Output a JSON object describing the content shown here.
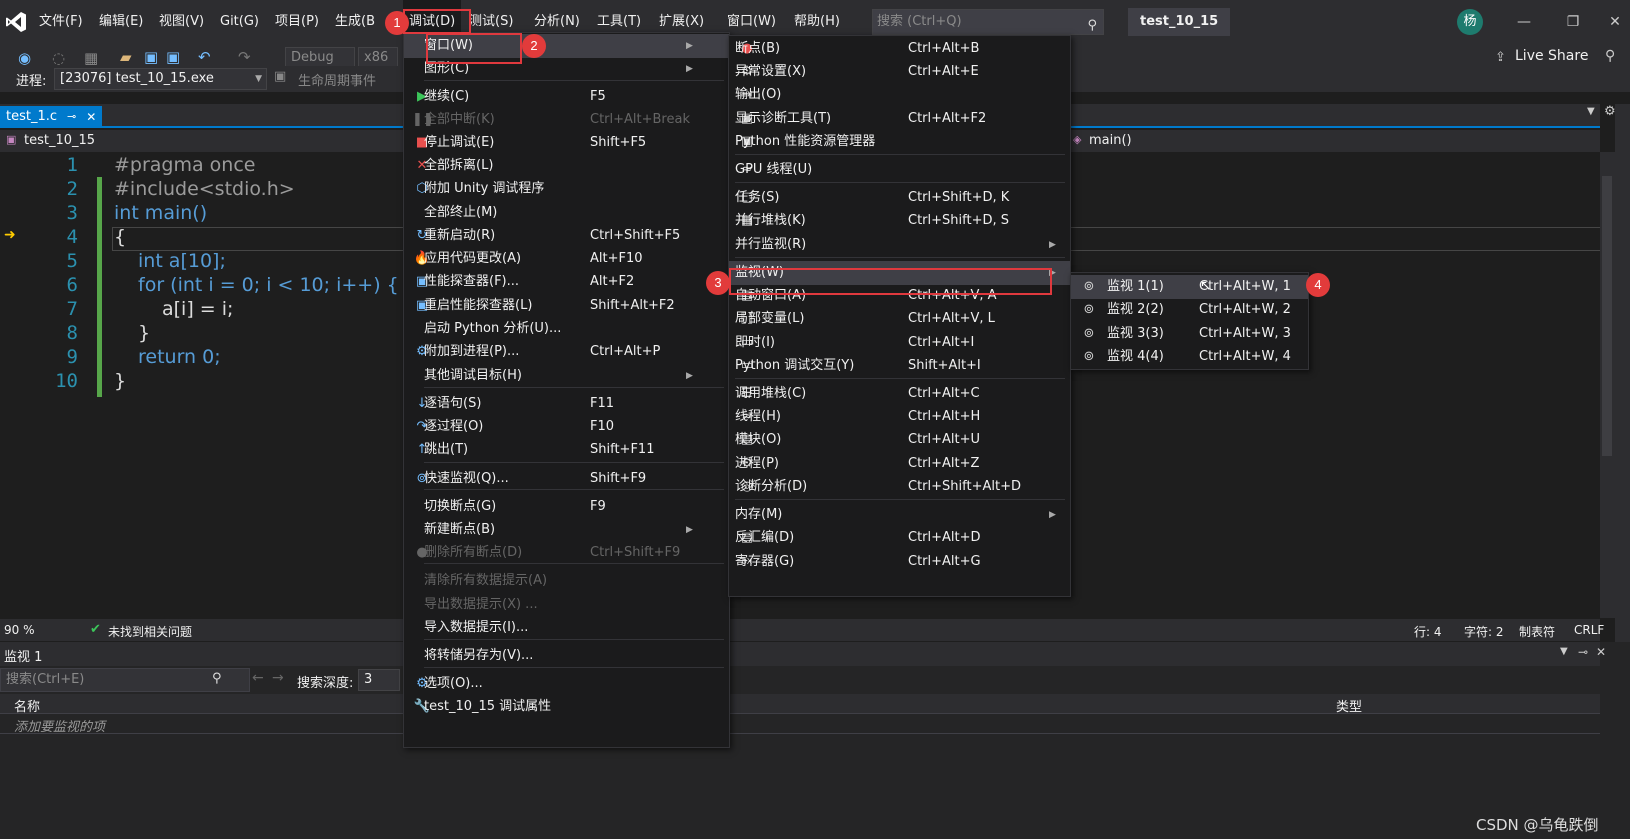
{
  "menubar": {
    "items": [
      "文件(F)",
      "编辑(E)",
      "视图(V)",
      "Git(G)",
      "项目(P)",
      "生成(B",
      "调试(D)",
      "测试(S)",
      "分析(N)",
      "工具(T)",
      "扩展(X)",
      "窗口(W)",
      "帮助(H)"
    ],
    "search_placeholder": "搜索 (Ctrl+Q)",
    "solution_name": "test_10_15",
    "avatar_initial": "杨",
    "live_share": "Live Share"
  },
  "toolbar": {
    "config": "Debug",
    "platform": "x86",
    "process_label": "进程:",
    "process_value": "[23076] test_10_15.exe",
    "lifecycle_label": "生命周期事件"
  },
  "tab": {
    "title": "test_1.c",
    "pin": "⊸",
    "close": "✕"
  },
  "navbar": {
    "project": "test_10_15",
    "member": "main()"
  },
  "editor": {
    "line_numbers": [
      "1",
      "2",
      "3",
      "4",
      "5",
      "6",
      "7",
      "8",
      "9",
      "10"
    ],
    "lines": [
      "#pragma once",
      "#include<stdio.h>",
      "int main()",
      "{",
      "    int a[10];",
      "    for (int i = 0; i < 10; i++) {",
      "        a[i] = i;",
      "    }",
      "    return 0;",
      "}"
    ]
  },
  "status": {
    "zoom": "90 %",
    "no_issues": "未找到相关问题",
    "line": "行: 4",
    "col": "字符: 2",
    "tab_mode": "制表符",
    "eol": "CRLF"
  },
  "watch": {
    "title": "监视 1",
    "search_placeholder": "搜索(Ctrl+E)",
    "depth_label": "搜索深度:",
    "depth_value": "3",
    "col_name": "名称",
    "col_type": "类型",
    "add_item": "添加要监视的项"
  },
  "debug_menu": {
    "items": [
      {
        "label": "窗口(W)",
        "shortcut": "",
        "icon": "",
        "submenu": true,
        "disabled": false,
        "highlighted": true
      },
      {
        "label": "图形(C)",
        "shortcut": "",
        "icon": "",
        "submenu": true,
        "disabled": false
      },
      {
        "label": "继续(C)",
        "shortcut": "F5",
        "icon": "▶",
        "disabled": false
      },
      {
        "label": "全部中断(K)",
        "shortcut": "Ctrl+Alt+Break",
        "icon": "❚❚",
        "disabled": true
      },
      {
        "label": "停止调试(E)",
        "shortcut": "Shift+F5",
        "icon": "■",
        "disabled": false
      },
      {
        "label": "全部拆离(L)",
        "shortcut": "",
        "icon": "✕",
        "disabled": false
      },
      {
        "label": "附加 Unity 调试程序",
        "shortcut": "",
        "icon": "⬡",
        "disabled": false
      },
      {
        "label": "全部终止(M)",
        "shortcut": "",
        "icon": "",
        "disabled": false
      },
      {
        "label": "重新启动(R)",
        "shortcut": "Ctrl+Shift+F5",
        "icon": "↻",
        "disabled": false
      },
      {
        "label": "应用代码更改(A)",
        "shortcut": "Alt+F10",
        "icon": "🔥",
        "disabled": false
      },
      {
        "label": "性能探查器(F)...",
        "shortcut": "Alt+F2",
        "icon": "▣",
        "disabled": false
      },
      {
        "label": "重启性能探查器(L)",
        "shortcut": "Shift+Alt+F2",
        "icon": "▣",
        "disabled": false
      },
      {
        "label": "启动 Python 分析(U)...",
        "shortcut": "",
        "icon": "",
        "disabled": false
      },
      {
        "label": "附加到进程(P)...",
        "shortcut": "Ctrl+Alt+P",
        "icon": "⚙",
        "disabled": false
      },
      {
        "label": "其他调试目标(H)",
        "shortcut": "",
        "icon": "",
        "submenu": true,
        "disabled": false
      },
      {
        "label": "逐语句(S)",
        "shortcut": "F11",
        "icon": "↓",
        "disabled": false
      },
      {
        "label": "逐过程(O)",
        "shortcut": "F10",
        "icon": "↷",
        "disabled": false
      },
      {
        "label": "跳出(T)",
        "shortcut": "Shift+F11",
        "icon": "↑",
        "disabled": false
      },
      {
        "label": "快速监视(Q)...",
        "shortcut": "Shift+F9",
        "icon": "⊚",
        "disabled": false
      },
      {
        "label": "切换断点(G)",
        "shortcut": "F9",
        "icon": "",
        "disabled": false
      },
      {
        "label": "新建断点(B)",
        "shortcut": "",
        "icon": "",
        "submenu": true,
        "disabled": false
      },
      {
        "label": "删除所有断点(D)",
        "shortcut": "Ctrl+Shift+F9",
        "icon": "●",
        "disabled": true
      },
      {
        "label": "清除所有数据提示(A)",
        "shortcut": "",
        "icon": "",
        "disabled": true
      },
      {
        "label": "导出数据提示(X) ...",
        "shortcut": "",
        "icon": "",
        "disabled": true
      },
      {
        "label": "导入数据提示(I)...",
        "shortcut": "",
        "icon": "",
        "disabled": false
      },
      {
        "label": "将转储另存为(V)...",
        "shortcut": "",
        "icon": "",
        "disabled": false
      },
      {
        "label": "选项(O)...",
        "shortcut": "",
        "icon": "⚙",
        "disabled": false
      },
      {
        "label": "test_10_15 调试属性",
        "shortcut": "",
        "icon": "🔧",
        "disabled": false
      }
    ]
  },
  "window_menu": {
    "items": [
      {
        "label": "断点(B)",
        "shortcut": "Ctrl+Alt+B",
        "icon": "●"
      },
      {
        "label": "异常设置(X)",
        "shortcut": "Ctrl+Alt+E",
        "icon": "⚙"
      },
      {
        "label": "输出(O)",
        "shortcut": "",
        "icon": "⇥"
      },
      {
        "label": "显示诊断工具(T)",
        "shortcut": "Ctrl+Alt+F2",
        "icon": "▣"
      },
      {
        "label": "Python 性能资源管理器",
        "shortcut": "",
        "icon": "▣"
      },
      {
        "label": "GPU 线程(U)",
        "shortcut": "",
        "icon": "≈"
      },
      {
        "label": "任务(S)",
        "shortcut": "Ctrl+Shift+D, K",
        "icon": "▢"
      },
      {
        "label": "并行堆栈(K)",
        "shortcut": "Ctrl+Shift+D, S",
        "icon": "▦"
      },
      {
        "label": "并行监视(R)",
        "shortcut": "",
        "icon": "",
        "submenu": true
      },
      {
        "label": "监视(W)",
        "shortcut": "",
        "icon": "",
        "submenu": true,
        "highlighted": true
      },
      {
        "label": "自动窗口(A)",
        "shortcut": "Ctrl+Alt+V, A",
        "icon": "▤"
      },
      {
        "label": "局部变量(L)",
        "shortcut": "Ctrl+Alt+V, L",
        "icon": "⟦⟧"
      },
      {
        "label": "即时(I)",
        "shortcut": "Ctrl+Alt+I",
        "icon": "▭"
      },
      {
        "label": "Python 调试交互(Y)",
        "shortcut": "Shift+Alt+I",
        "icon": "▭"
      },
      {
        "label": "调用堆栈(C)",
        "shortcut": "Ctrl+Alt+C",
        "icon": "☰"
      },
      {
        "label": "线程(H)",
        "shortcut": "Ctrl+Alt+H",
        "icon": "≈"
      },
      {
        "label": "模块(O)",
        "shortcut": "Ctrl+Alt+U",
        "icon": "▤"
      },
      {
        "label": "进程(P)",
        "shortcut": "Ctrl+Alt+Z",
        "icon": "⚙"
      },
      {
        "label": "诊断分析(D)",
        "shortcut": "Ctrl+Shift+Alt+D",
        "icon": "◎"
      },
      {
        "label": "内存(M)",
        "shortcut": "",
        "icon": "",
        "submenu": true
      },
      {
        "label": "反汇编(D)",
        "shortcut": "Ctrl+Alt+D",
        "icon": "▤"
      },
      {
        "label": "寄存器(G)",
        "shortcut": "Ctrl+Alt+G",
        "icon": "0X"
      }
    ]
  },
  "watch_submenu": {
    "items": [
      {
        "label": "监视 1(1)",
        "shortcut": "Ctrl+Alt+W, 1"
      },
      {
        "label": "监视 2(2)",
        "shortcut": "Ctrl+Alt+W, 2"
      },
      {
        "label": "监视 3(3)",
        "shortcut": "Ctrl+Alt+W, 3"
      },
      {
        "label": "监视 4(4)",
        "shortcut": "Ctrl+Alt+W, 4"
      }
    ]
  },
  "annotations": {
    "b1": "1",
    "b2": "2",
    "b3": "3",
    "b4": "4"
  },
  "watermark": "CSDN @乌龟跌倒",
  "colors": {
    "accent": "#007acc",
    "annotation": "#e23b3b",
    "menu_bg": "#1b1b1c",
    "highlight": "#3f3f46"
  }
}
